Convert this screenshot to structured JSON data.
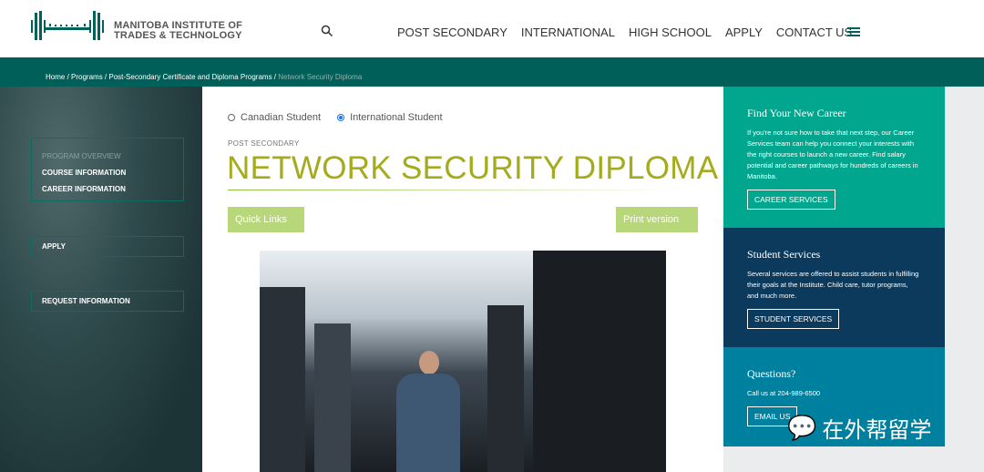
{
  "header": {
    "logo_line1": "MANITOBA INSTITUTE OF",
    "logo_line2": "TRADES & TECHNOLOGY",
    "nav": [
      "POST SECONDARY",
      "INTERNATIONAL",
      "HIGH SCHOOL",
      "APPLY",
      "CONTACT US"
    ]
  },
  "breadcrumb": [
    "Home",
    "Programs",
    "Post-Secondary Certificate and Diploma Programs",
    "Network Security Diploma"
  ],
  "sidebar": {
    "program_overview": "PROGRAM OVERVIEW",
    "course_info": "COURSE INFORMATION",
    "career_info": "CAREER INFORMATION",
    "apply": "APPLY",
    "request_info": "REQUEST INFORMATION"
  },
  "main": {
    "radio_canadian": "Canadian Student",
    "radio_international": "International Student",
    "selected": "International Student",
    "kicker": "POST SECONDARY",
    "title": "NETWORK SECURITY DIPLOMA",
    "quick_links": "Quick Links",
    "print": "Print version"
  },
  "right": {
    "career": {
      "title": "Find Your New Career",
      "text": "If you're not sure how to take that next step, our Career Services team can help you connect your interests with the right courses to launch a new career. Find salary potential and career pathways for hundreds of careers in Manitoba.",
      "button": "CAREER SERVICES",
      "color": "#00a78e"
    },
    "student": {
      "title": "Student Services",
      "text": "Several services are offered to assist students in fulfilling their goals at the Institute. Child care, tutor programs, and much more.",
      "button": "STUDENT SERVICES",
      "color": "#0b3a5c"
    },
    "questions": {
      "title": "Questions?",
      "text": "Call us at 204-989-6500",
      "button": "EMAIL US",
      "color": "#00809f"
    }
  },
  "watermark": "在外帮留学"
}
